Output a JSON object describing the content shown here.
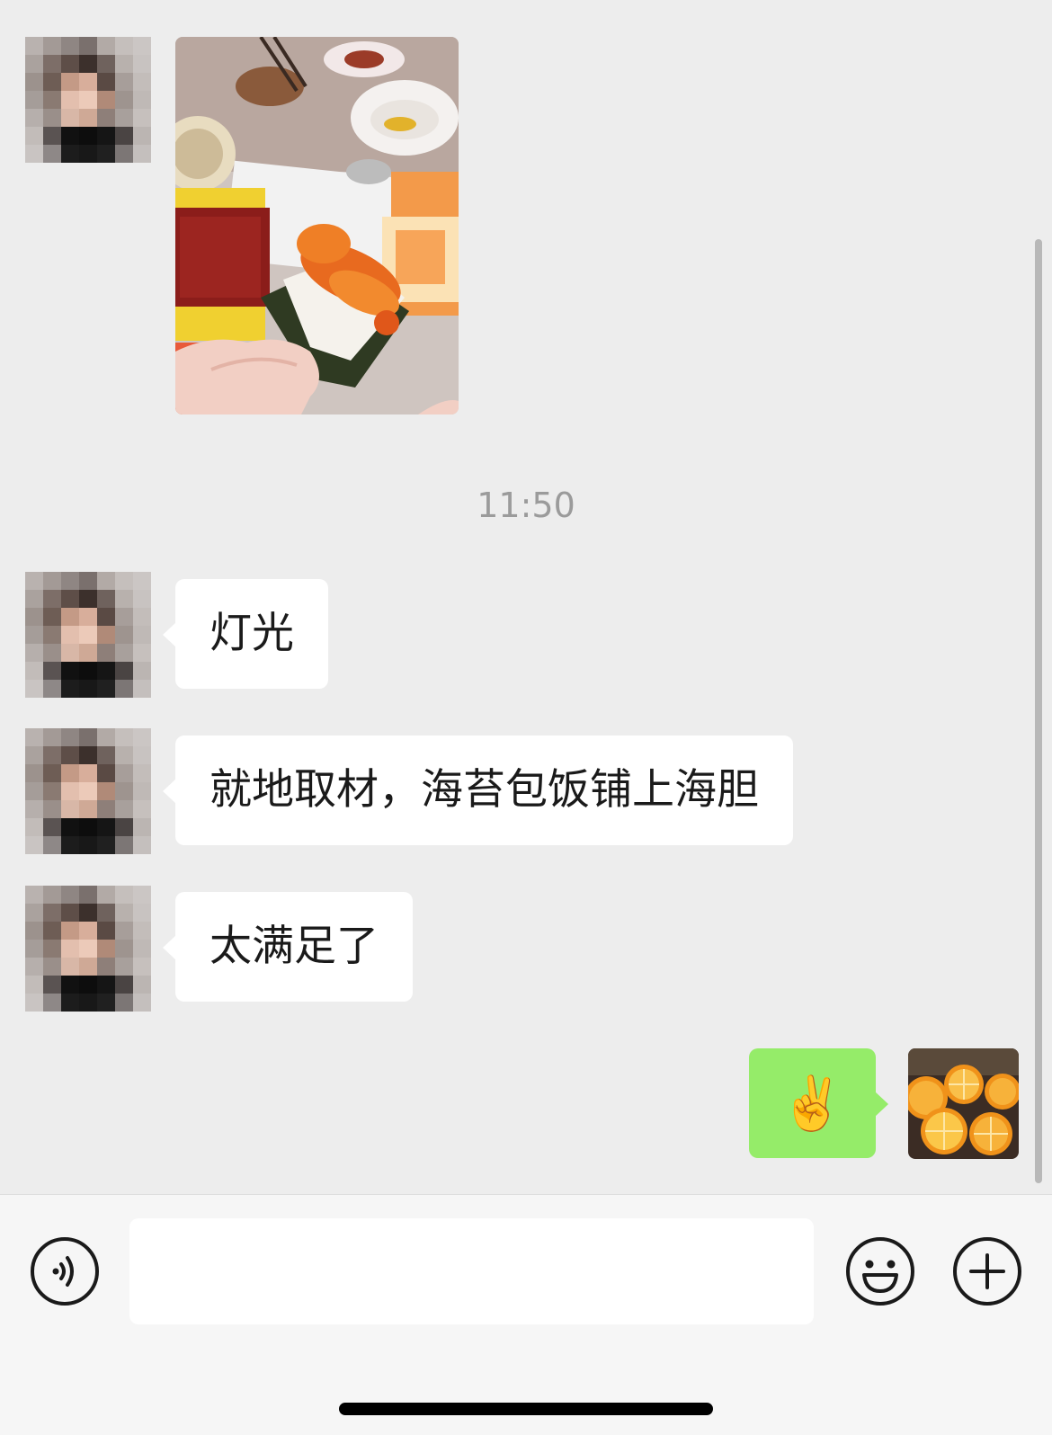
{
  "chat": {
    "timestamp": "11:50",
    "messages": [
      {
        "from": "contact",
        "kind": "image",
        "image": "sea-urchin-sushi-photo"
      },
      {
        "from": "contact",
        "kind": "text",
        "text": "灯光"
      },
      {
        "from": "contact",
        "kind": "text",
        "text": "就地取材，海苔包饭铺上海胆"
      },
      {
        "from": "contact",
        "kind": "text",
        "text": "太满足了"
      },
      {
        "from": "me",
        "kind": "emoji",
        "text": "✌️"
      }
    ]
  },
  "input_bar": {
    "message_value": "",
    "voice_icon": "voice-input-icon",
    "emoji_icon": "emoji-face-icon",
    "more_icon": "plus-circle-icon"
  },
  "colors": {
    "background": "#ededed",
    "incoming_bubble": "#ffffff",
    "outgoing_bubble": "#95ec69",
    "timestamp_text": "#9b9b9b",
    "input_bar": "#f6f6f6"
  }
}
